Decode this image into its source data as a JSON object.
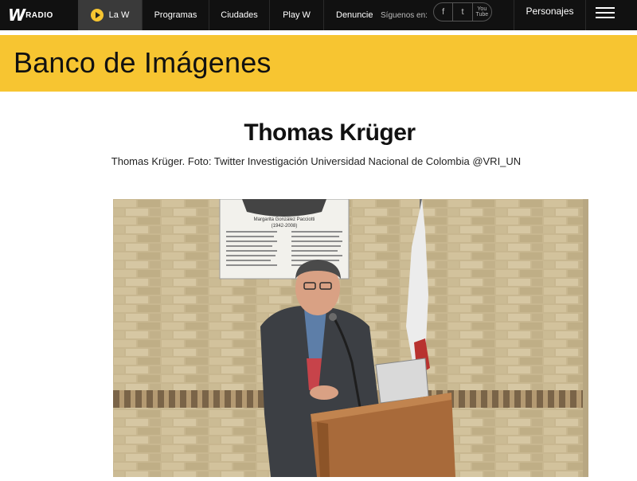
{
  "brand": {
    "logo_mark": "W",
    "logo_text": "RADIO"
  },
  "nav": {
    "live_label": "La W",
    "items": [
      "Programas",
      "Ciudades",
      "Play W",
      "Denuncie"
    ],
    "follow_label": "Síguenos en:",
    "social_icons": [
      "facebook-icon",
      "twitter-icon",
      "youtube-icon"
    ],
    "facebook": "f",
    "twitter": "t",
    "youtube": "You Tube",
    "personajes": "Personajes"
  },
  "banner": {
    "title": "Banco de Imágenes"
  },
  "article": {
    "title": "Thomas Krüger",
    "caption": "Thomas Krüger. Foto: Twitter Investigación Universidad Nacional de Colombia @VRI_UN"
  },
  "photo": {
    "plaque_name": "Margarita González Pacciotti",
    "plaque_years": "(1942-2008)"
  },
  "colors": {
    "accent": "#f7c531",
    "nav_bg": "#111111",
    "nav_active": "#3a3a3a"
  }
}
